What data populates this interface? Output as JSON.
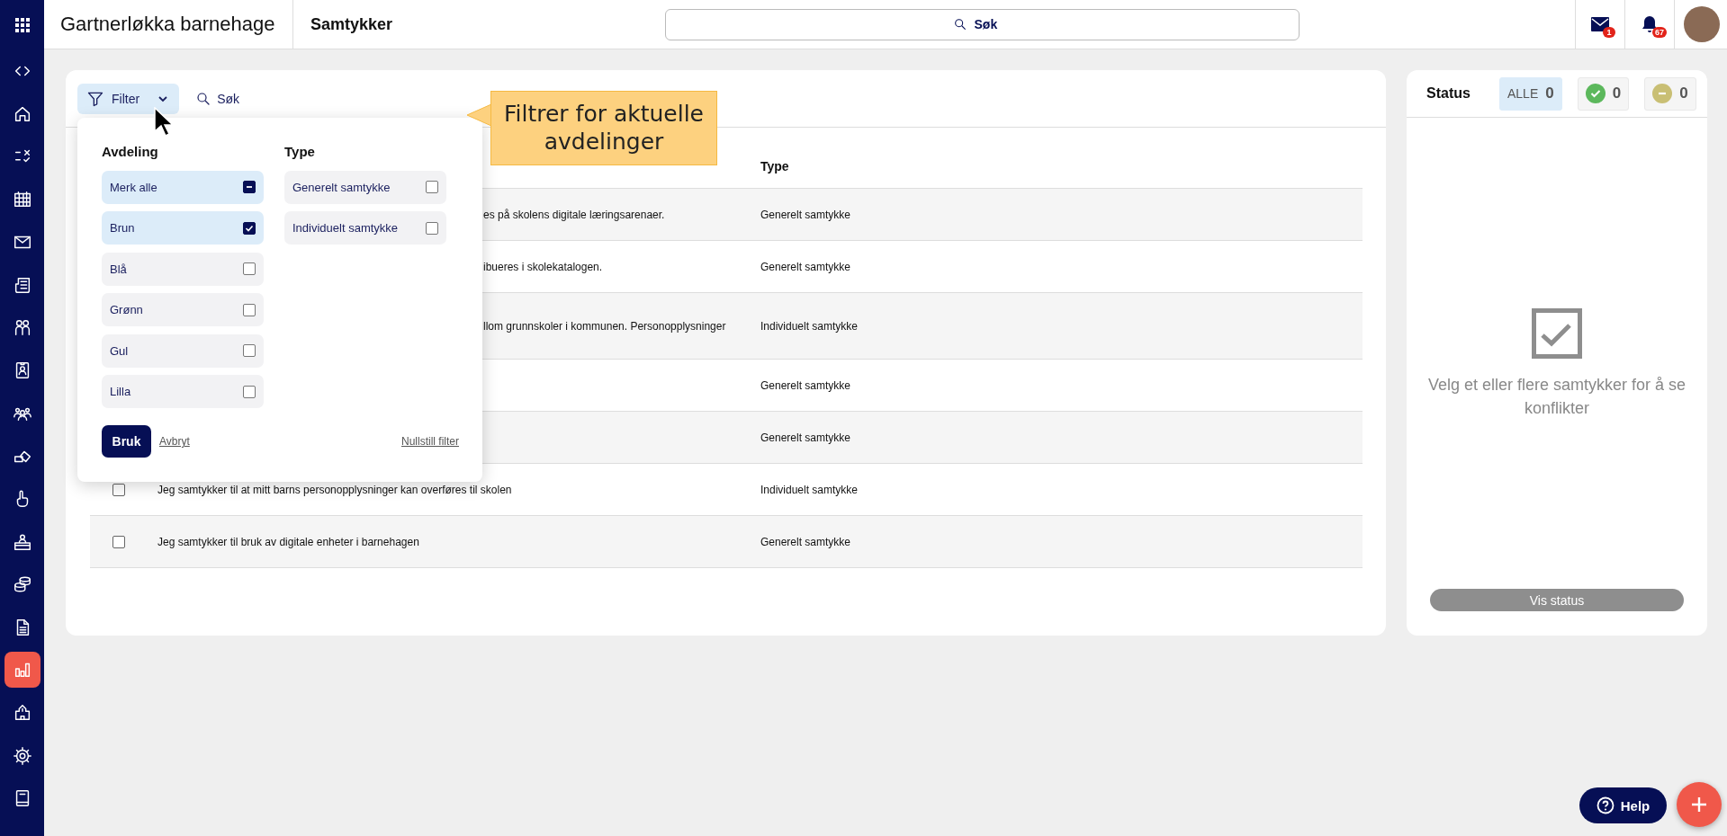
{
  "topbar": {
    "app_title": "Gartnerløkka barnehage",
    "page_title": "Samtykker",
    "search": {
      "placeholder": "Søk"
    },
    "messages_badge": "1",
    "notifications_badge": "67"
  },
  "sidebar": {
    "items": [
      {
        "selected": false
      },
      {
        "selected": false
      },
      {
        "selected": false
      },
      {
        "selected": false
      },
      {
        "selected": false
      },
      {
        "selected": false
      },
      {
        "selected": false
      },
      {
        "selected": false
      },
      {
        "selected": false
      },
      {
        "selected": false
      },
      {
        "selected": false
      },
      {
        "selected": false
      },
      {
        "selected": false
      },
      {
        "selected": false
      },
      {
        "selected": true
      },
      {
        "selected": false
      },
      {
        "selected": false
      },
      {
        "selected": false
      }
    ]
  },
  "toolbar": {
    "filter_label": "Filter",
    "filter_open": true,
    "search_label": "Søk"
  },
  "filter_panel": {
    "groups": [
      {
        "heading": "Avdeling",
        "options": [
          {
            "kind": "select-all",
            "label": "Merk alle",
            "checked": true
          },
          {
            "kind": "option",
            "label": "Brun",
            "checked": true
          },
          {
            "kind": "option",
            "label": "Blå",
            "checked": false
          },
          {
            "kind": "option",
            "label": "Grønn",
            "checked": false
          },
          {
            "kind": "option",
            "label": "Gul",
            "checked": false
          },
          {
            "kind": "option",
            "label": "Lilla",
            "checked": false
          }
        ]
      },
      {
        "heading": "Type",
        "options": [
          {
            "kind": "option",
            "label": "Generelt samtykke",
            "checked": false
          },
          {
            "kind": "option",
            "label": "Individuelt samtykke",
            "checked": false
          }
        ]
      }
    ],
    "apply": "Bruk",
    "cancel": "Avbryt",
    "reset": "Nullstill filter"
  },
  "callout": {
    "text": "Filtrer for aktuelle avdelinger"
  },
  "table": {
    "type_column": "Type",
    "rows": [
      {
        "description": "es på skolens digitale læringsarenaer.",
        "covered": true,
        "type": "Generelt samtykke"
      },
      {
        "description": "ibueres i skolekatalogen.",
        "covered": true,
        "type": "Generelt samtykke"
      },
      {
        "description": "llom grunnskoler i kommunen. Personopplysninger",
        "covered": true,
        "type": "Individuelt samtykke"
      },
      {
        "type": "Generelt samtykke"
      },
      {
        "type": "Generelt samtykke"
      },
      {
        "description": "Jeg samtykker til at mitt barns personopplysninger kan overføres til skolen",
        "covered": false,
        "checked": false,
        "type": "Individuelt samtykke"
      },
      {
        "description": "Jeg samtykker til bruk av digitale enheter i barnehagen",
        "covered": false,
        "checked": false,
        "type": "Generelt samtykke"
      }
    ]
  },
  "status": {
    "title": "Status",
    "filters": [
      {
        "kind": "all",
        "label": "ALLE",
        "count": "0",
        "selected": true
      },
      {
        "kind": "approved",
        "count": "0",
        "selected": false
      },
      {
        "kind": "declined",
        "count": "0",
        "selected": false
      }
    ],
    "empty_message": "Velg et eller flere samtykker for å se konflikter",
    "button": "Vis status"
  },
  "help": "Help"
}
